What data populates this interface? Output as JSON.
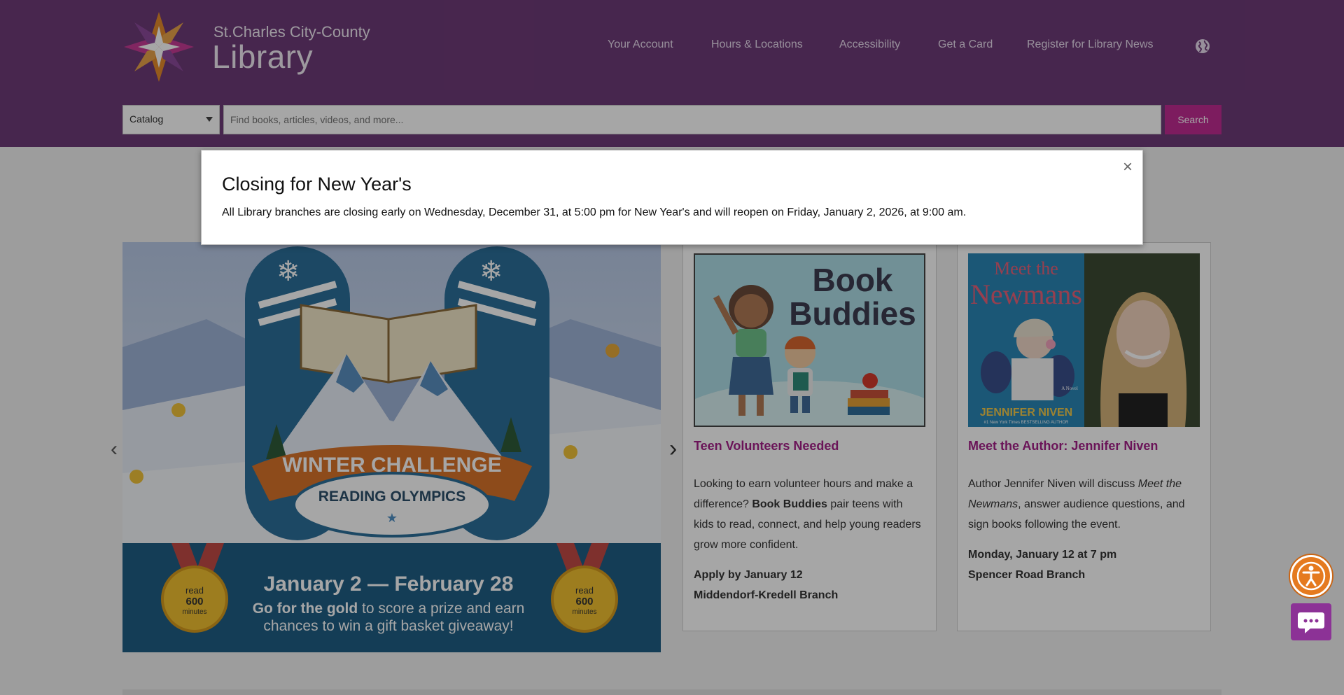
{
  "header": {
    "brand_small": "St.Charles City-County",
    "brand_big": "Library",
    "nav": [
      "Your Account",
      "Hours & Locations",
      "Accessibility",
      "Get a Card",
      "Register for Library News"
    ],
    "globe_icon": "globe-icon"
  },
  "search": {
    "scope": "Catalog",
    "placeholder": "Find books, articles, videos, and more...",
    "button": "Search"
  },
  "hero": {
    "title": "WINTER CHALLENGE",
    "subtitle": "READING OLYMPICS",
    "dates": "January 2 — February 28",
    "tag_bold": "Go for the gold",
    "tag_rest": " to score a prize and earn",
    "tag_line2": "chances to win a gift basket giveaway!",
    "medal_1": "read",
    "medal_2": "600",
    "medal_3": "minutes"
  },
  "cards": [
    {
      "image_title_1": "Book",
      "image_title_2": "Buddies",
      "title": "Teen Volunteers Needed",
      "desc_1": "Looking to earn volunteer hours and make a difference? ",
      "desc_bold": "Book Buddies",
      "desc_2": " pair teens with kids to read, connect, and help young readers grow more confident.",
      "meta_1": "Apply by January 12",
      "meta_2": "Middendorf-Kredell Branch"
    },
    {
      "image_title_1": "Meet the",
      "image_title_2": "Newmans",
      "image_author": "JENNIFER NIVEN",
      "image_tagline": "#1 New York Times BESTSELLING AUTHOR",
      "image_novel": "A Novel",
      "title": "Meet the Author: Jennifer Niven",
      "desc_1": "Author Jennifer Niven will discuss ",
      "desc_italic": "Meet the Newmans",
      "desc_2": ", answer audience questions, and sign books following the event.",
      "meta_1": "Monday, January 12 at 7 pm",
      "meta_2": "Spencer Road Branch"
    }
  ],
  "modal": {
    "title": "Closing for New Year's",
    "body": "All Library branches are closing early on Wednesday, December 31, at 5:00 pm for New Year's and will reopen on Friday, January 2, 2026, at 9:00 am.",
    "close": "×"
  },
  "colors": {
    "header_bg": "#6e3b78",
    "accent": "#c02b93",
    "link": "#a41f87",
    "a11y_orange": "#e57a1f",
    "chat_purple": "#8c3296"
  }
}
